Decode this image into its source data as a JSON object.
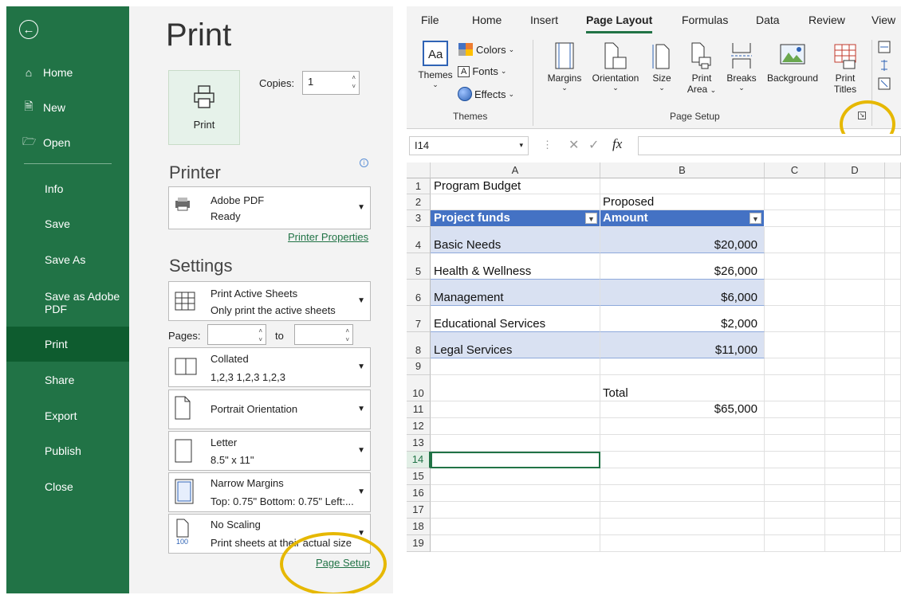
{
  "backstage": {
    "nav": {
      "home": "Home",
      "new": "New",
      "open": "Open",
      "info": "Info",
      "save": "Save",
      "save_as": "Save As",
      "save_as_pdf_1": "Save as Adobe",
      "save_as_pdf_2": "PDF",
      "print": "Print",
      "share": "Share",
      "export": "Export",
      "publish": "Publish",
      "close": "Close"
    },
    "title": "Print",
    "print_button": "Print",
    "copies_label": "Copies:",
    "copies_value": "1",
    "printer_heading": "Printer",
    "printer_name": "Adobe PDF",
    "printer_status": "Ready",
    "printer_properties": "Printer Properties",
    "settings_heading": "Settings",
    "sheets_line1": "Print Active Sheets",
    "sheets_line2": "Only print the active sheets",
    "pages_label": "Pages:",
    "to_label": "to",
    "collate_line1": "Collated",
    "collate_line2": "1,2,3   1,2,3   1,2,3",
    "orientation": "Portrait Orientation",
    "paper_line1": "Letter",
    "paper_line2": "8.5\" x 11\"",
    "margins_line1": "Narrow Margins",
    "margins_line2": "Top: 0.75\" Bottom: 0.75\" Left:...",
    "scaling_line1": "No Scaling",
    "scaling_line2": "Print sheets at their actual size",
    "scaling_icon_num": "100",
    "page_setup_link": "Page Setup"
  },
  "excel": {
    "tabs": [
      "File",
      "Home",
      "Insert",
      "Page Layout",
      "Formulas",
      "Data",
      "Review",
      "View"
    ],
    "active_tab": "Page Layout",
    "themes_group": {
      "themes": "Themes",
      "colors": "Colors",
      "fonts": "Fonts",
      "effects": "Effects",
      "label": "Themes"
    },
    "page_setup_group": {
      "margins": "Margins",
      "orientation": "Orientation",
      "size": "Size",
      "print_area_1": "Print",
      "print_area_2": "Area",
      "breaks": "Breaks",
      "background": "Background",
      "print_titles_1": "Print",
      "print_titles_2": "Titles",
      "label": "Page Setup"
    },
    "name_box": "I14",
    "fx_symbol": "fx",
    "columns": [
      "A",
      "B",
      "C",
      "D"
    ],
    "rows": [
      "1",
      "2",
      "3",
      "4",
      "5",
      "6",
      "7",
      "8",
      "9",
      "10",
      "11",
      "12",
      "13",
      "14",
      "15",
      "16",
      "17",
      "18",
      "19"
    ],
    "cells": {
      "a1": "Program Budget",
      "b2": "Proposed",
      "a3": "Project funds",
      "b3": "Amount",
      "a4": "Basic Needs",
      "b4": "$20,000",
      "a5": "Health & Wellness",
      "b5": "$26,000",
      "a6": "Management",
      "b6": "$6,000",
      "a7": "Educational Services",
      "b7": "$2,000",
      "a8": "Legal Services",
      "b8": "$11,000",
      "b10": "Total",
      "b11": "$65,000"
    },
    "colors": {
      "table_header": "#4472c4",
      "table_band": "#d9e1f2",
      "accent": "#217346",
      "highlight": "#e6b800"
    }
  }
}
